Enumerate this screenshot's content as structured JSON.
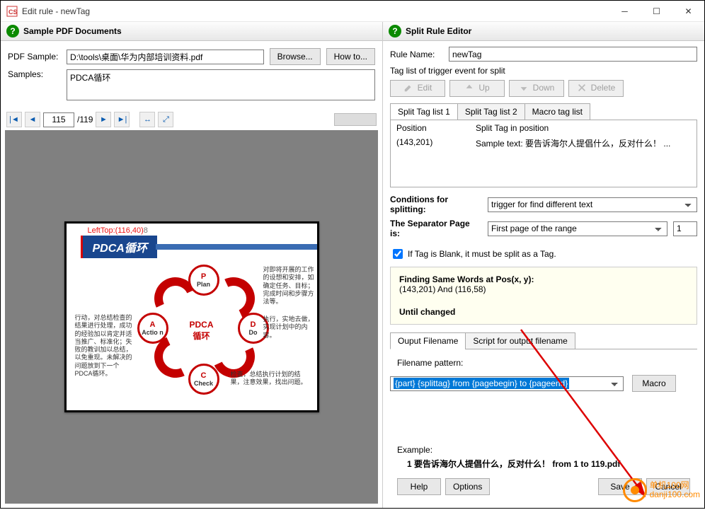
{
  "window": {
    "title": "Edit rule - newTag"
  },
  "left": {
    "header": "Sample PDF Documents",
    "pdf_sample_label": "PDF Sample:",
    "pdf_sample_value": "D:\\tools\\桌面\\华为内部培训资料.pdf",
    "browse": "Browse...",
    "howto": "How to...",
    "samples_label": "Samples:",
    "samples_value": "PDCA循环",
    "page_current": "115",
    "page_total": "/119",
    "preview": {
      "coord": "LeftTop:(116,40)",
      "coord2": "8",
      "ribbon": "PDCA循环",
      "center1": "PDCA",
      "center2": "循环",
      "nodes": {
        "plan": "Plan",
        "do": "Do",
        "check": "Check",
        "action": "Actio n"
      },
      "tb1": "对即将开展的工作的设想和安排，如确定任务、目标；完成时间和步骤方法等。",
      "tb2": "执行，实地去做，实现计划中的内容。",
      "tb3": "检查，总结执行计划的结果，注意效果，找出问题。",
      "tb4": "行动，对总结检查的结果进行处理，成功的经验加以肯定并适当推广、标准化；失败的教训加以总结，以免重现。未解决的问题放到下一个PDCA循环。"
    }
  },
  "right": {
    "header": "Split Rule Editor",
    "rule_name_label": "Rule Name:",
    "rule_name_value": "newTag",
    "tag_list_label": "Tag list of trigger event for split",
    "btn_edit": "Edit",
    "btn_up": "Up",
    "btn_down": "Down",
    "btn_delete": "Delete",
    "tabs": {
      "t1": "Split Tag list 1",
      "t2": "Split Tag list 2",
      "t3": "Macro tag list"
    },
    "table": {
      "h1": "Position",
      "h2": "Split Tag in position",
      "c1": "(143,201)",
      "c2": "Sample text: 要告诉海尔人提倡什么，反对什么！ ..."
    },
    "cond_label": "Conditions for splitting:",
    "cond_value": "trigger for find different text",
    "sep_label": "The Separator Page is:",
    "sep_value": "First page of the range",
    "sep_num": "1",
    "blank_cb": "If Tag is Blank, it must be split as a Tag.",
    "yellow": {
      "l1": "Finding Same Words at Pos(x, y):",
      "l2": "(143,201) And (116,58)",
      "l3": "Until changed"
    },
    "otabs": {
      "t1": "Ouput Filename",
      "t2": "Script for output filename"
    },
    "filename_label": "Filename pattern:",
    "filename_value": "{part} {splittag} from {pagebegin} to {pageend}",
    "macro_btn": "Macro",
    "example_label": "Example:",
    "example_value_b": "1 要告诉海尔人提倡什么，反对什么！",
    "example_value_r": " from 1 to 119.pdf",
    "help": "Help",
    "options": "Options",
    "save": "Save",
    "cancel": "Cancel"
  },
  "watermark": {
    "line1": "单机100网",
    "line2": "danji100.com"
  }
}
